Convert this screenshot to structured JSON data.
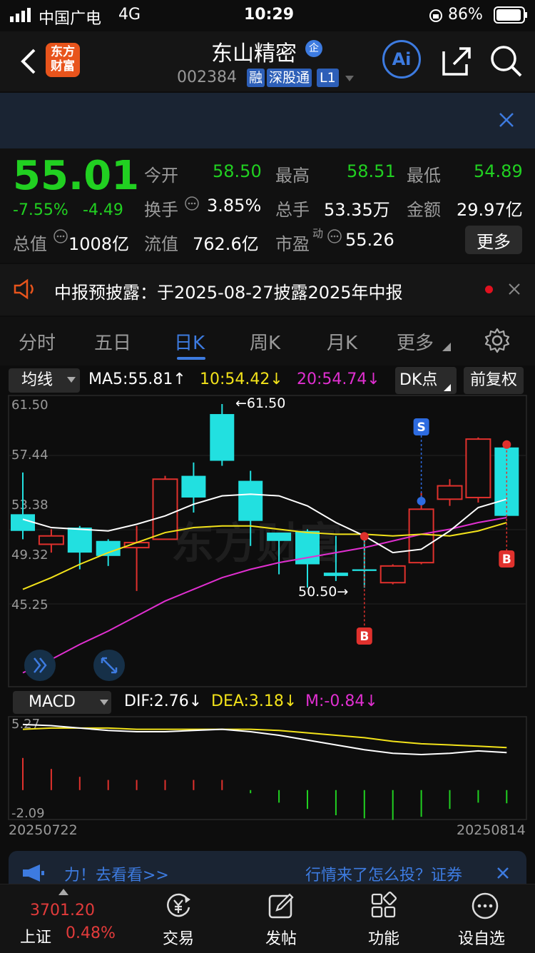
{
  "status": {
    "carrier": "中国广电",
    "network": "4G",
    "time": "10:29",
    "battery": "86%"
  },
  "header": {
    "back_icon": "chevron-left-icon",
    "logo_text": "东方\n财富",
    "title": "东山精密",
    "title_badge": "企",
    "code": "002384",
    "tags": [
      "融",
      "深股通",
      "L1"
    ],
    "ai_label": "Ai"
  },
  "quote": {
    "price": "55.01",
    "change_pct": "-7.55%",
    "change": "-4.49",
    "labels": {
      "open": "今开",
      "high": "最高",
      "low": "最低",
      "turnover": "换手",
      "volume": "总手",
      "amount": "金额",
      "mktcap": "总值",
      "float": "流值",
      "pe": "市盈",
      "pe_sup": "动"
    },
    "values": {
      "open": "58.50",
      "high": "58.51",
      "low": "54.89",
      "turnover": "3.85%",
      "volume": "53.35万",
      "amount": "29.97亿",
      "mktcap": "1008亿",
      "float": "762.6亿",
      "pe": "55.26"
    },
    "more": "更多"
  },
  "notice": {
    "text": "中报预披露：于2025-08-27披露2025年中报"
  },
  "tabs": [
    "分时",
    "五日",
    "日K",
    "周K",
    "月K",
    "更多"
  ],
  "active_tab": "日K",
  "chart_head": {
    "ma_select": "均线",
    "ma5": "MA5:55.81↑",
    "ma10": "10:54.42↓",
    "ma20": "20:54.74↓",
    "dk": "DK点",
    "fq": "前复权"
  },
  "kline_axis": [
    "61.50",
    "57.44",
    "53.38",
    "49.32",
    "45.25"
  ],
  "annotations": {
    "high": "←61.50",
    "low": "50.50→",
    "buy": "B",
    "sell": "S"
  },
  "macd_head": {
    "select": "MACD",
    "dif": "DIF:2.76↓",
    "dea": "DEA:3.18↓",
    "m": "M:-0.84↓"
  },
  "macd_axis": [
    "5.27",
    "-2.09"
  ],
  "dates": {
    "start": "20250722",
    "end": "20250814"
  },
  "ad": {
    "left": "力！去看看>>",
    "right": "行情来了怎么投？证券"
  },
  "bottom": {
    "index_value": "3701.20",
    "index_name": "上证",
    "index_pct": "0.48%",
    "items": [
      "交易",
      "发帖",
      "功能",
      "设自选"
    ]
  },
  "chart_data": {
    "type": "candlestick",
    "y_range": [
      45.25,
      61.5
    ],
    "candles": [
      {
        "o": 54.9,
        "c": 53.9,
        "h": 57.4,
        "l": 53.4
      },
      {
        "o": 53.1,
        "c": 53.6,
        "h": 54.0,
        "l": 52.6
      },
      {
        "o": 54.1,
        "c": 52.6,
        "h": 54.2,
        "l": 51.6
      },
      {
        "o": 53.3,
        "c": 52.4,
        "h": 53.4,
        "l": 51.8
      },
      {
        "o": 52.9,
        "c": 53.2,
        "h": 54.2,
        "l": 50.3
      },
      {
        "o": 53.4,
        "c": 57.0,
        "h": 57.2,
        "l": 53.4
      },
      {
        "o": 57.2,
        "c": 55.9,
        "h": 58.0,
        "l": 55.0
      },
      {
        "o": 60.9,
        "c": 58.1,
        "h": 61.5,
        "l": 57.8
      },
      {
        "o": 56.9,
        "c": 54.5,
        "h": 57.5,
        "l": 53.0
      },
      {
        "o": 53.8,
        "c": 53.3,
        "h": 53.8,
        "l": 51.3
      },
      {
        "o": 53.9,
        "c": 51.9,
        "h": 54.0,
        "l": 50.5
      },
      {
        "o": 51.4,
        "c": 51.2,
        "h": 53.6,
        "l": 50.9
      },
      {
        "o": 51.6,
        "c": 51.5,
        "h": 53.4,
        "l": 50.5
      },
      {
        "o": 50.8,
        "c": 51.8,
        "h": 51.9,
        "l": 50.7
      },
      {
        "o": 52.0,
        "c": 55.2,
        "h": 56.2,
        "l": 51.9
      },
      {
        "o": 55.8,
        "c": 56.6,
        "h": 57.0,
        "l": 55.4
      },
      {
        "o": 55.9,
        "c": 59.4,
        "h": 59.5,
        "l": 55.6
      },
      {
        "o": 58.9,
        "c": 54.8,
        "h": 58.9,
        "l": 54.8
      }
    ],
    "ma5": [
      54.6,
      54.1,
      54.0,
      53.9,
      54.3,
      54.8,
      55.5,
      56.0,
      56.1,
      56.0,
      55.4,
      54.4,
      53.6,
      52.6,
      52.8,
      53.9,
      55.3,
      55.8
    ],
    "ma10": [
      50.4,
      51.1,
      51.9,
      52.6,
      53.2,
      53.8,
      54.1,
      54.2,
      54.2,
      54.0,
      53.8,
      53.7,
      53.7,
      53.6,
      53.7,
      53.6,
      53.9,
      54.4
    ],
    "ma20": [
      45.4,
      46.2,
      47.1,
      47.9,
      48.8,
      49.7,
      50.4,
      51.1,
      51.6,
      52.0,
      52.3,
      52.6,
      52.9,
      53.3,
      53.7,
      54.0,
      54.4,
      54.7
    ],
    "macd_range": [
      -2.09,
      5.27
    ],
    "dif": [
      5.1,
      5.0,
      4.8,
      4.6,
      4.5,
      4.5,
      4.6,
      4.7,
      4.5,
      4.2,
      3.8,
      3.4,
      3.0,
      2.7,
      2.6,
      2.7,
      2.9,
      2.76
    ],
    "dea": [
      4.7,
      4.8,
      4.8,
      4.8,
      4.7,
      4.7,
      4.7,
      4.7,
      4.7,
      4.6,
      4.4,
      4.2,
      4.0,
      3.7,
      3.5,
      3.4,
      3.3,
      3.18
    ],
    "macd_hist": [
      1.5,
      0.8,
      0.3,
      0.1,
      0.1,
      0.1,
      0.1,
      0.1,
      -0.2,
      -0.8,
      -1.2,
      -1.6,
      -1.8,
      -1.9,
      -1.7,
      -1.2,
      -0.8,
      -0.84
    ],
    "signals": [
      {
        "index": 12,
        "type": "B"
      },
      {
        "index": 14,
        "type": "S"
      },
      {
        "index": 17,
        "type": "B"
      }
    ]
  }
}
